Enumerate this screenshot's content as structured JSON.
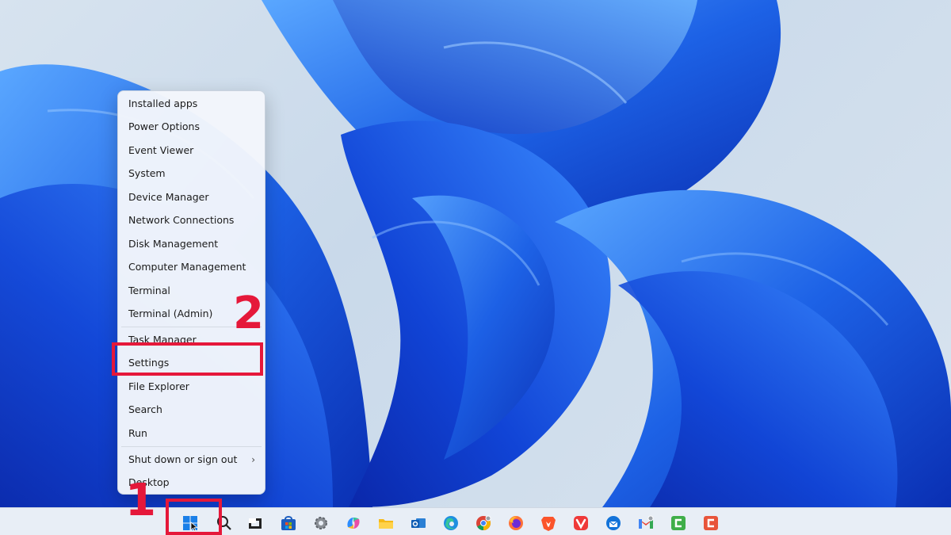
{
  "context_menu": {
    "items": [
      {
        "label": "Installed apps"
      },
      {
        "label": "Power Options"
      },
      {
        "label": "Event Viewer"
      },
      {
        "label": "System"
      },
      {
        "label": "Device Manager"
      },
      {
        "label": "Network Connections"
      },
      {
        "label": "Disk Management"
      },
      {
        "label": "Computer Management"
      },
      {
        "label": "Terminal"
      },
      {
        "label": "Terminal (Admin)"
      },
      {
        "label": "Task Manager"
      },
      {
        "label": "Settings"
      },
      {
        "label": "File Explorer"
      },
      {
        "label": "Search"
      },
      {
        "label": "Run"
      },
      {
        "label": "Shut down or sign out"
      },
      {
        "label": "Desktop"
      }
    ]
  },
  "annotations": {
    "step1": "1",
    "step2": "2",
    "color": "#e5183a"
  },
  "taskbar": {
    "icons": [
      "windows-start-icon",
      "search-icon",
      "task-view-icon",
      "microsoft-store-icon",
      "settings-gear-icon",
      "copilot-icon",
      "file-explorer-icon",
      "outlook-icon",
      "edge-icon",
      "chrome-icon",
      "firefox-icon",
      "brave-icon",
      "vivaldi-icon",
      "thunderbird-icon",
      "gmail-icon",
      "green-c-app-icon",
      "red-c-app-icon"
    ]
  },
  "colors": {
    "wallpaper_blue": "#1a5fe0",
    "accent_red": "#e5183a"
  }
}
